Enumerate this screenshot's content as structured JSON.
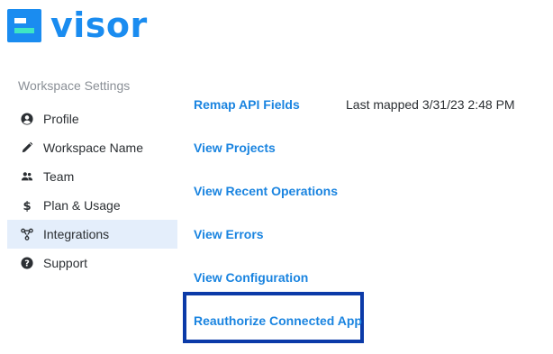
{
  "logo": {
    "text": "visor",
    "brand_color": "#1a8cf0",
    "accent_color": "#3ee6c4"
  },
  "sidebar": {
    "heading": "Workspace Settings",
    "items": [
      {
        "label": "Profile",
        "icon": "user-circle-icon",
        "active": false
      },
      {
        "label": "Workspace Name",
        "icon": "pencil-icon",
        "active": false
      },
      {
        "label": "Team",
        "icon": "users-icon",
        "active": false
      },
      {
        "label": "Plan & Usage",
        "icon": "dollar-icon",
        "active": false
      },
      {
        "label": "Integrations",
        "icon": "integrations-icon",
        "active": true
      },
      {
        "label": "Support",
        "icon": "question-circle-icon",
        "active": false
      }
    ]
  },
  "main": {
    "links": [
      {
        "label": "Remap API Fields"
      },
      {
        "label": "View Projects"
      },
      {
        "label": "View Recent Operations"
      },
      {
        "label": "View Errors"
      },
      {
        "label": "View Configuration"
      },
      {
        "label": "Reauthorize Connected App"
      }
    ],
    "last_mapped": "Last mapped 3/31/23 2:48 PM"
  },
  "colors": {
    "link": "#1a84e0",
    "active_bg": "#e4eefb",
    "highlight_border": "#0b3aa8"
  }
}
